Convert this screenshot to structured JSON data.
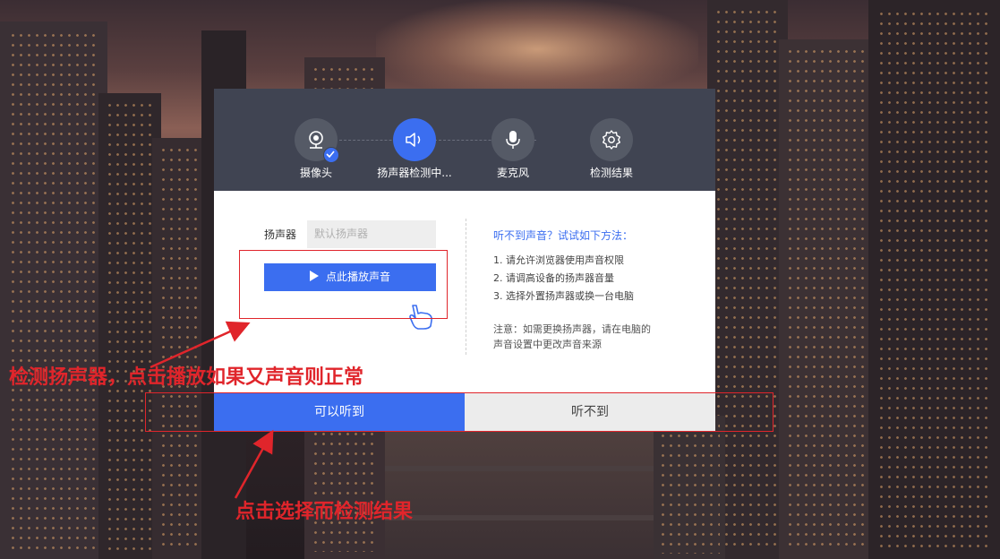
{
  "steps": [
    {
      "label": "摄像头",
      "icon": "camera-icon",
      "state": "done"
    },
    {
      "label": "扬声器检测中...",
      "icon": "speaker-icon",
      "state": "active"
    },
    {
      "label": "麦克风",
      "icon": "microphone-icon",
      "state": "pending"
    },
    {
      "label": "检测结果",
      "icon": "gear-icon",
      "state": "pending"
    }
  ],
  "speaker": {
    "label": "扬声器",
    "select_value": "默认扬声器",
    "play_label": "点此播放声音"
  },
  "help": {
    "title": "听不到声音？试试如下方法：",
    "items": [
      "1. 请允许浏览器使用声音权限",
      "2. 请调高设备的扬声器音量",
      "3. 选择外置扬声器或换一台电脑"
    ],
    "note_line1": "注意：如需更换扬声器，请在电脑的",
    "note_line2": "声音设置中更改声音来源"
  },
  "buttons": {
    "yes": "可以听到",
    "no": "听不到"
  },
  "annotations": {
    "top": "检测扬声器，点击播放如果又声音则正常",
    "bottom": "点击选择而检测结果"
  },
  "colors": {
    "accent": "#3b6ef0",
    "header_bg": "#404452",
    "annotation": "#e0252b"
  }
}
